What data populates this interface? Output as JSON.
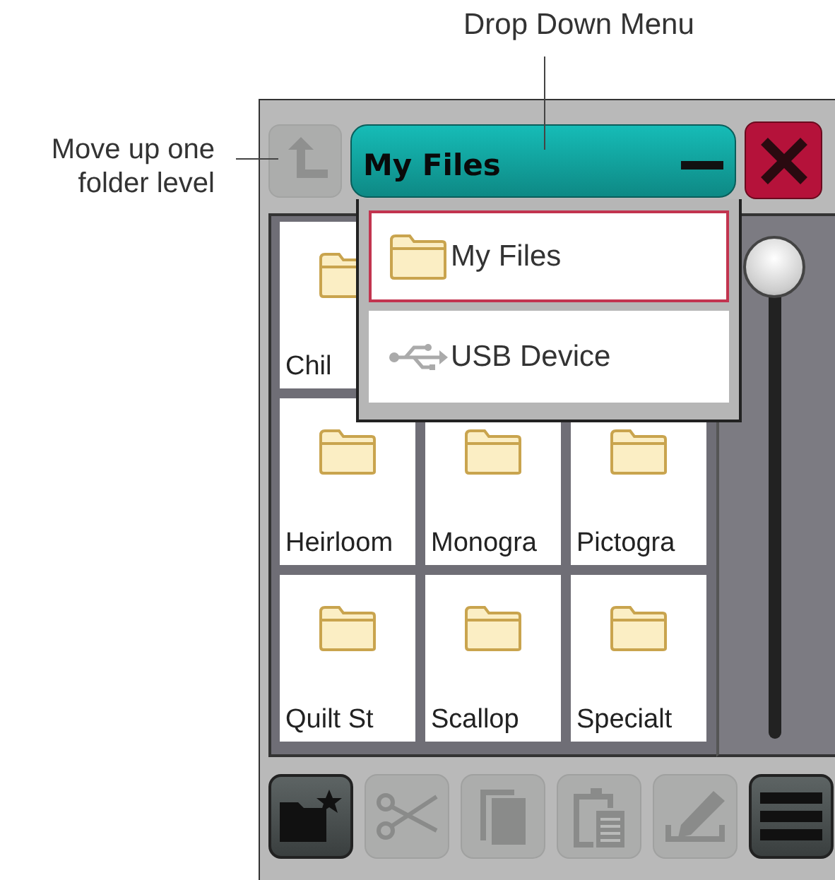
{
  "callouts": [
    {
      "kind": "top",
      "text": "Drop Down Menu"
    },
    {
      "kind": "left",
      "text": "Move up one folder level"
    }
  ],
  "up_button": {
    "disabled": true
  },
  "location_button": {
    "label": "My Files",
    "expanded": true
  },
  "dropdown": [
    {
      "kind": "folder",
      "label": "My Files",
      "selected": true
    },
    {
      "kind": "usb",
      "label": "USB Device",
      "selected": false
    }
  ],
  "file_rows": [
    [
      {
        "name": "Chil"
      }
    ],
    [
      {
        "name": "Heirloom"
      },
      {
        "name": "Monogra"
      },
      {
        "name": "Pictogra"
      }
    ],
    [
      {
        "name": "Quilt St"
      },
      {
        "name": "Scallop"
      },
      {
        "name": "Specialt"
      }
    ]
  ],
  "toolbar": [
    {
      "kind": "new-folder",
      "disabled": false
    },
    {
      "kind": "cut",
      "disabled": true
    },
    {
      "kind": "copy",
      "disabled": true
    },
    {
      "kind": "paste",
      "disabled": true
    },
    {
      "kind": "rename",
      "disabled": true
    },
    {
      "kind": "menu",
      "disabled": false
    }
  ]
}
